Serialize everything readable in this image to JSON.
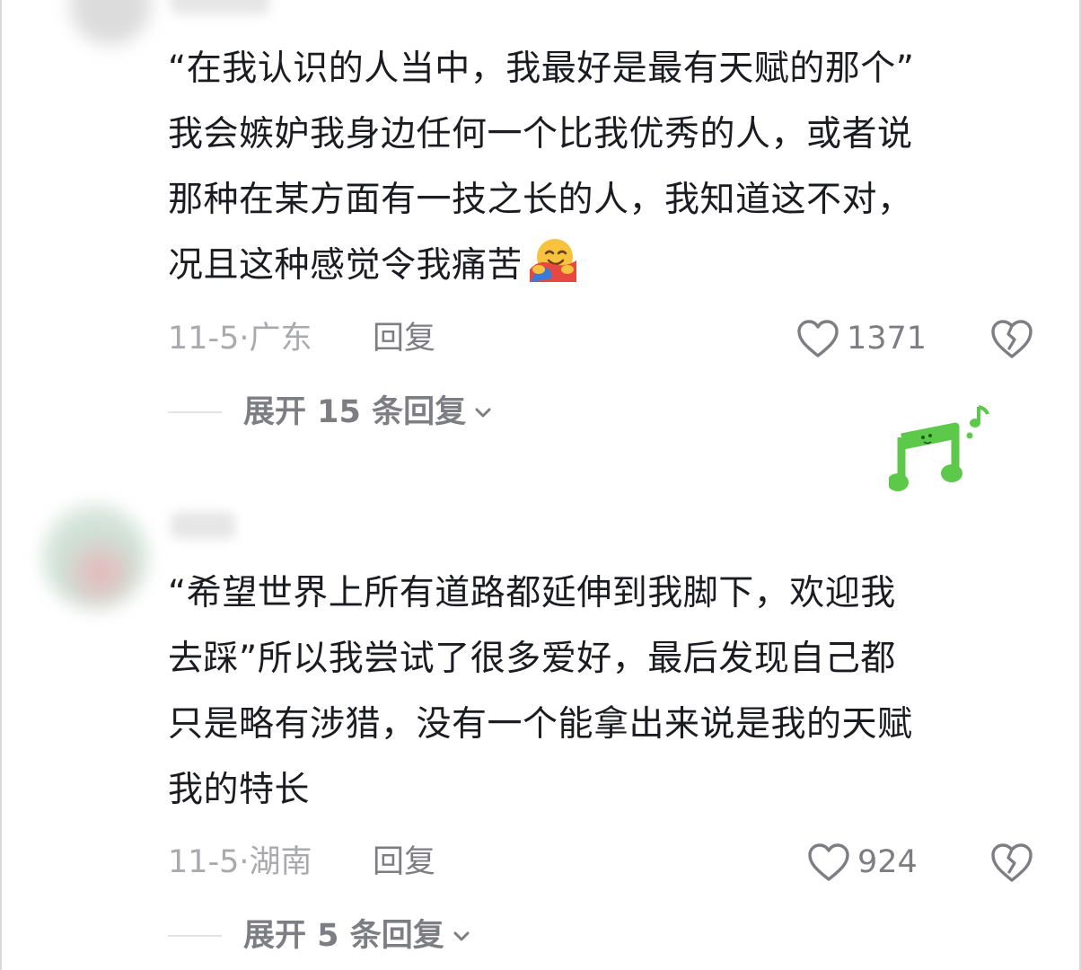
{
  "comments": [
    {
      "text_lines": [
        "“在我认识的人当中，我最好是最有天赋的那个”",
        "我会嫉妒我身边任何一个比我优秀的人，或者说",
        "那种在某方面有一技之长的人，我知道这不对，",
        "况且这种感觉令我痛苦"
      ],
      "emoji": "hugging-face-emoji",
      "date_location": "11-5·广东",
      "reply_label": "回复",
      "like_count": "1371",
      "expand_label": "展开 15 条回复"
    },
    {
      "text_lines": [
        "“希望世界上所有道路都延伸到我脚下，欢迎我",
        "去踩”所以我尝试了很多爱好，最后发现自己都",
        "只是略有涉猎，没有一个能拿出来说是我的天赋",
        "我的特长"
      ],
      "date_location": "11-5·湖南",
      "reply_label": "回复",
      "like_count": "924",
      "expand_label": "展开 5 条回复"
    }
  ],
  "icons": {
    "like": "heart-outline-icon",
    "dislike": "broken-heart-icon",
    "expand": "chevron-down-icon",
    "sticker": "music-note-sticker"
  },
  "colors": {
    "text_primary": "#1b1c22",
    "text_secondary": "#7d7e84",
    "text_muted": "#a9aaae",
    "sticker_green": "#5cc94a"
  }
}
